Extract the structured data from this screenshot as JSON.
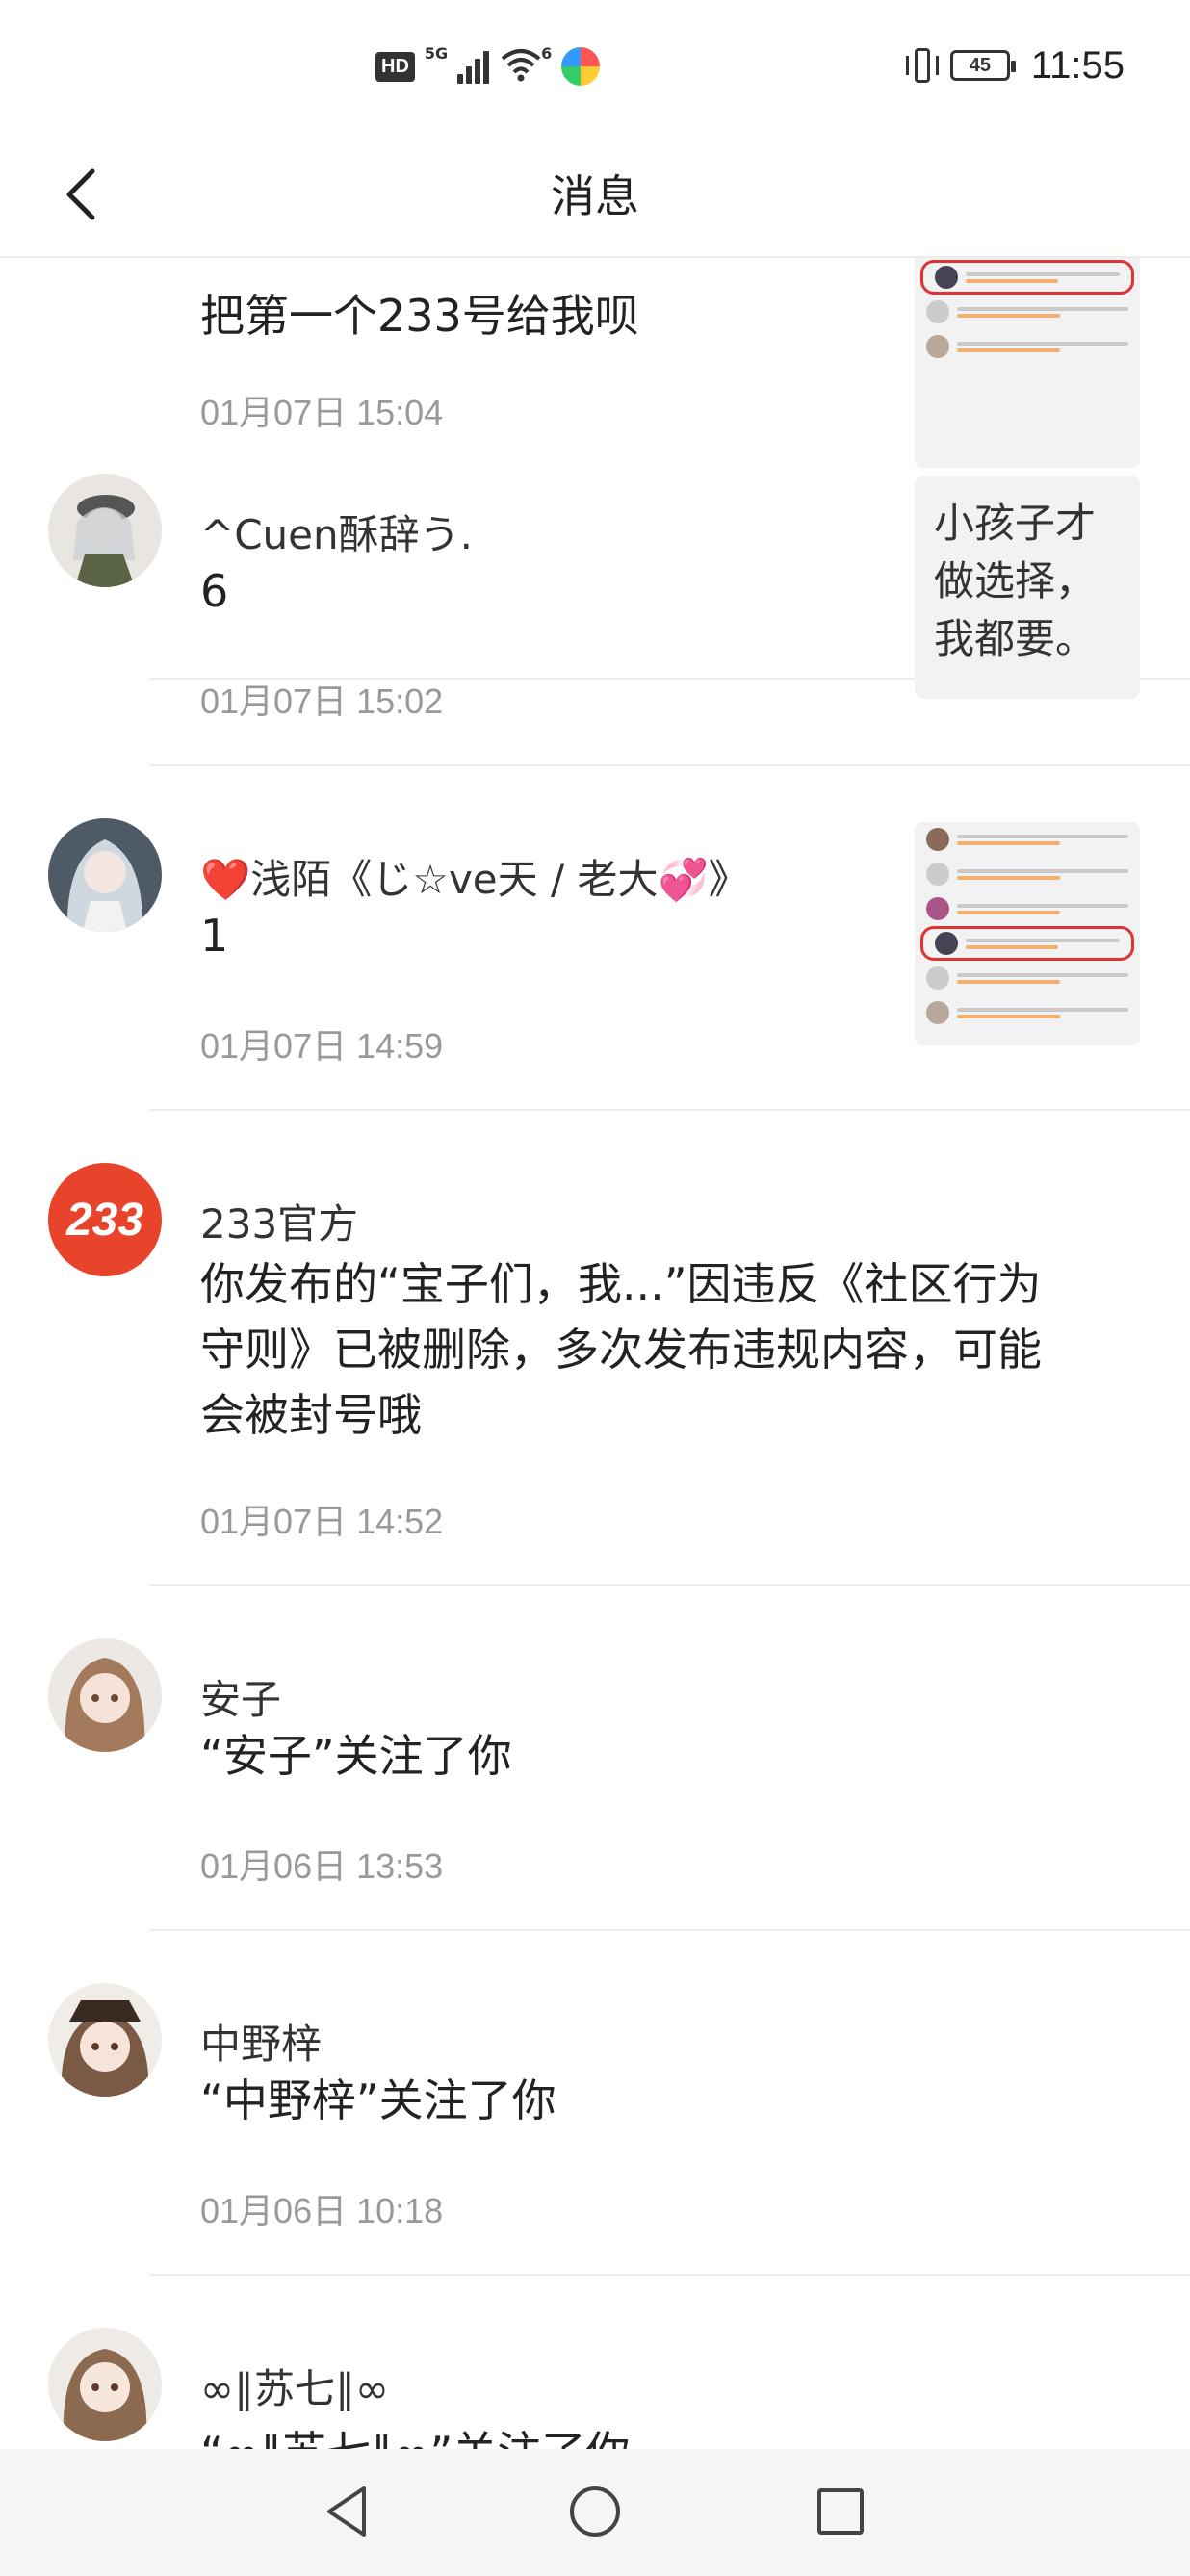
{
  "status_bar": {
    "hd": "HD",
    "network": "5G",
    "wifi_label": "6",
    "battery": "45",
    "time": "11:55"
  },
  "header": {
    "title": "消息"
  },
  "messages": [
    {
      "name": "",
      "text": "把第一个233号给我呗",
      "time": "01月07日 15:04",
      "attachment": "screenshot-thumbnail"
    },
    {
      "name": "^Cuen酥辞う.",
      "text": "6",
      "time": "01月07日 15:02",
      "quote": "小孩子才做选择，我都要。"
    },
    {
      "name": "❤️浅陌《じ☆ve天 / 老大💞》",
      "text": "1",
      "time": "01月07日 14:59",
      "attachment": "screenshot-thumbnail"
    },
    {
      "name": "233官方",
      "avatar_text": "233",
      "text": "你发布的“宝子们，我...”因违反《社区行为守则》已被删除，多次发布违规内容，可能会被封号哦",
      "time": "01月07日 14:52"
    },
    {
      "name": "安子",
      "text": "“安子”关注了你",
      "time": "01月06日 13:53"
    },
    {
      "name": "中野梓",
      "text": "“中野梓”关注了你",
      "time": "01月06日 10:18"
    },
    {
      "name": "∞∥苏七∥∞",
      "text": "“∞∥苏七∥∞”关注了你"
    }
  ],
  "colors": {
    "accent_red": "#e8442b",
    "text_primary": "#222222",
    "text_secondary": "#999999",
    "divider": "#ededed"
  },
  "navbar": {
    "back_icon": "triangle-back-icon",
    "home_icon": "circle-home-icon",
    "recents_icon": "square-recents-icon"
  }
}
